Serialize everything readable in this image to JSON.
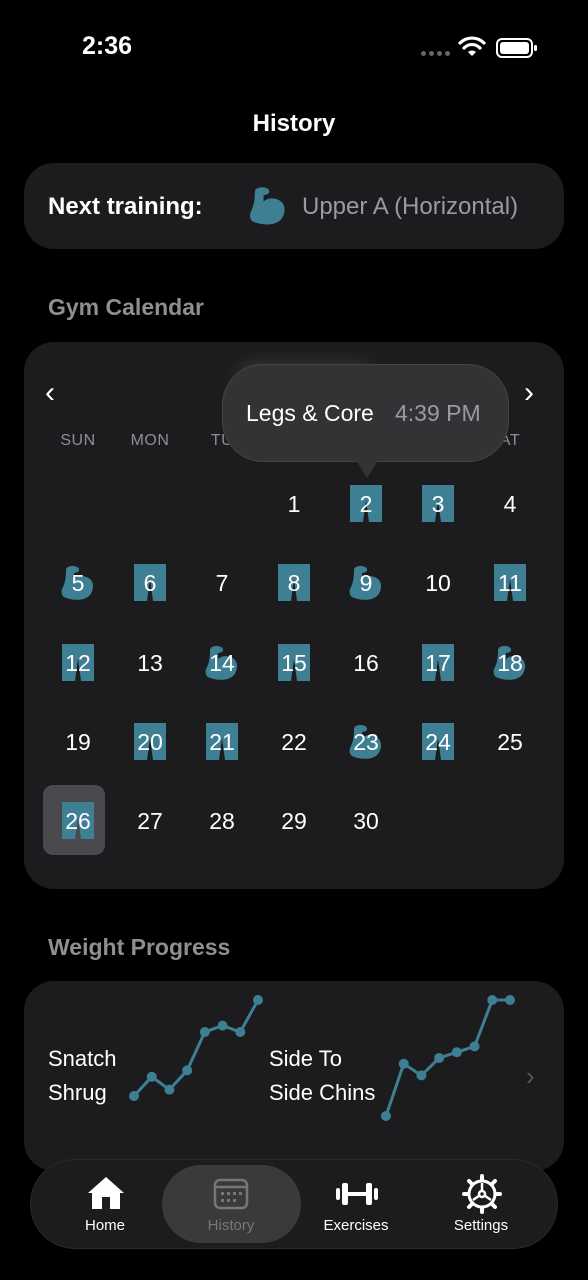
{
  "status": {
    "time": "2:36"
  },
  "nav": {
    "title": "History"
  },
  "next_training": {
    "label": "Next training:",
    "value": "Upper A (Horizontal)",
    "icon": "flexed-biceps-icon"
  },
  "calendar": {
    "section_title": "Gym Calendar",
    "weekdays": [
      "SUN",
      "MON",
      "TU",
      "",
      "",
      "",
      "AT"
    ],
    "tooltip": {
      "name": "Legs & Core",
      "time": "4:39 PM"
    },
    "days": [
      {
        "d": "1",
        "type": ""
      },
      {
        "d": "2",
        "type": "legs"
      },
      {
        "d": "3",
        "type": "legs"
      },
      {
        "d": "4",
        "type": ""
      },
      {
        "d": "5",
        "type": "arm"
      },
      {
        "d": "6",
        "type": "legs"
      },
      {
        "d": "7",
        "type": ""
      },
      {
        "d": "8",
        "type": "legs"
      },
      {
        "d": "9",
        "type": "arm"
      },
      {
        "d": "10",
        "type": ""
      },
      {
        "d": "11",
        "type": "legs"
      },
      {
        "d": "12",
        "type": "legs"
      },
      {
        "d": "13",
        "type": ""
      },
      {
        "d": "14",
        "type": "arm"
      },
      {
        "d": "15",
        "type": "legs"
      },
      {
        "d": "16",
        "type": ""
      },
      {
        "d": "17",
        "type": "legs"
      },
      {
        "d": "18",
        "type": "arm"
      },
      {
        "d": "19",
        "type": ""
      },
      {
        "d": "20",
        "type": "legs"
      },
      {
        "d": "21",
        "type": "legs"
      },
      {
        "d": "22",
        "type": ""
      },
      {
        "d": "23",
        "type": "arm"
      },
      {
        "d": "24",
        "type": "legs"
      },
      {
        "d": "25",
        "type": ""
      },
      {
        "d": "26",
        "type": "legs",
        "selected": true
      },
      {
        "d": "27",
        "type": ""
      },
      {
        "d": "28",
        "type": ""
      },
      {
        "d": "29",
        "type": ""
      },
      {
        "d": "30",
        "type": ""
      }
    ],
    "accent": "#3f7f94"
  },
  "weight_progress": {
    "section_title": "Weight Progress",
    "items": [
      {
        "line1": "Snatch",
        "line2": "Shrug",
        "trend": [
          2,
          5,
          3,
          6,
          12,
          13,
          12,
          17
        ]
      },
      {
        "line1": "Side To",
        "line2": "Side Chins",
        "trend": [
          2,
          11,
          9,
          12,
          13,
          14,
          22,
          22
        ]
      }
    ]
  },
  "tabs": [
    {
      "label": "Home",
      "icon": "house-icon"
    },
    {
      "label": "History",
      "icon": "calendar-icon",
      "active": true
    },
    {
      "label": "Exercises",
      "icon": "dumbbell-icon"
    },
    {
      "label": "Settings",
      "icon": "gear-icon"
    }
  ]
}
